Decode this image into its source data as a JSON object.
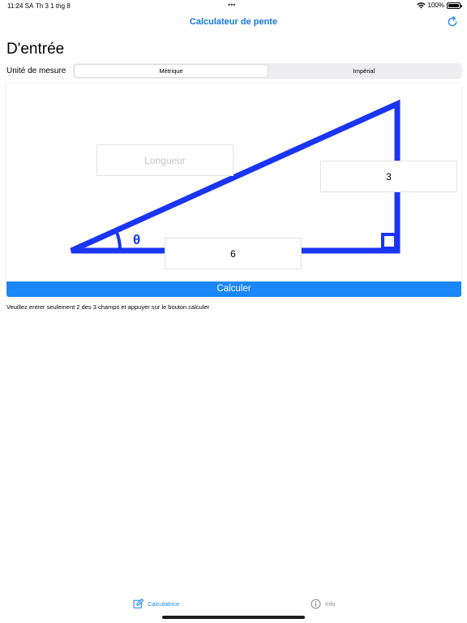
{
  "status_bar": {
    "time": "11:24 SA",
    "date": "Th 3 1 thg 8",
    "dots": "•••",
    "battery": "100%"
  },
  "nav": {
    "title": "Calculateur de pente",
    "refresh_icon": "refresh-icon"
  },
  "page": {
    "title": "D'entrée"
  },
  "units": {
    "label": "Unité de mesure",
    "options": [
      "Métrique",
      "Impérial"
    ],
    "selected": "Métrique"
  },
  "diagram": {
    "angle_symbol": "θ",
    "length_placeholder": "Longueur",
    "length_value": "",
    "height_value": "3",
    "base_value": "6",
    "line_color": "#1a35f5"
  },
  "actions": {
    "calculate_label": "Calculer"
  },
  "instructions": "Veuillez entrer seulement 2 des 3 champs et appuyer sur le bouton calculer",
  "tabs": [
    {
      "label": "Calculatrice",
      "icon": "edit-icon",
      "active": true
    },
    {
      "label": "Info",
      "icon": "info-icon",
      "active": false
    }
  ],
  "colors": {
    "accent": "#1a86f7",
    "triangle": "#1a35f5"
  }
}
